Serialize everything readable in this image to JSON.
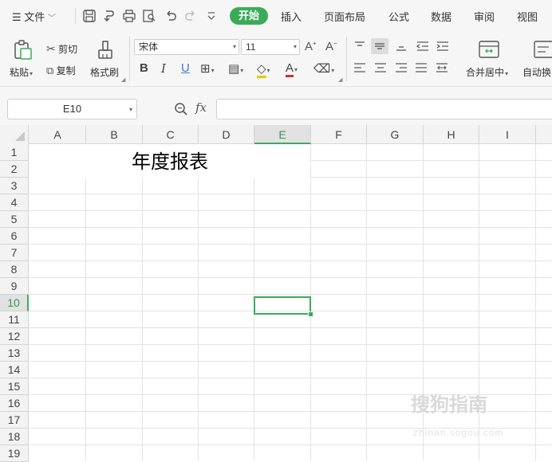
{
  "menu": {
    "file_label": "文件",
    "tabs": [
      "开始",
      "插入",
      "页面布局",
      "公式",
      "数据",
      "审阅",
      "视图"
    ],
    "active_tab": "开始"
  },
  "ribbon": {
    "paste_label": "粘贴",
    "cut_label": "剪切",
    "copy_label": "复制",
    "format_painter_label": "格式刷",
    "font_name": "宋体",
    "font_size": "11",
    "merge_center_label": "合并居中",
    "wrap_label": "自动换"
  },
  "formula_bar": {
    "cell_ref": "E10",
    "fx_label": "fx",
    "formula_value": ""
  },
  "sheet": {
    "columns": [
      "A",
      "B",
      "C",
      "D",
      "E",
      "F",
      "G",
      "H",
      "I"
    ],
    "rows": [
      "1",
      "2",
      "3",
      "4",
      "5",
      "6",
      "7",
      "8",
      "9",
      "10",
      "11",
      "12",
      "13",
      "14",
      "15",
      "16",
      "17",
      "18",
      "19"
    ],
    "selected_column": "E",
    "selected_row": "10",
    "merged_title": "年度报表"
  },
  "watermark": {
    "text": "搜狗指南",
    "sub": "zhinan.sogou.com"
  },
  "colors": {
    "accent": "#3cab58",
    "toolbar_bg": "#f6f6f6",
    "header_bg": "#f3f3f3",
    "gridline": "#e3e3e3"
  }
}
